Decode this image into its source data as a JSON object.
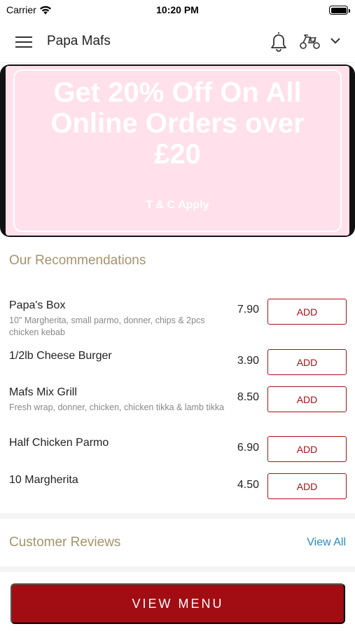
{
  "status_bar": {
    "carrier": "Carrier",
    "time": "10:20 PM"
  },
  "header": {
    "title": "Papa Mafs"
  },
  "banner": {
    "headline": "Get 20% Off On All\nOnline Orders over\n£20",
    "terms": "T & C Apply",
    "background": "#ffe0eb"
  },
  "recommendations": {
    "title": "Our Recommendations",
    "add_label": "ADD",
    "items": [
      {
        "name": "Papa's Box",
        "description": "10\" Margherita, small parmo, donner, chips & 2pcs chicken kebab",
        "price": "7.90"
      },
      {
        "name": "1/2lb Cheese Burger",
        "description": "",
        "price": "3.90"
      },
      {
        "name": "Mafs Mix Grill",
        "description": "Fresh wrap, donner, chicken, chicken tikka & lamb tikka",
        "price": "8.50"
      },
      {
        "name": "Half Chicken Parmo",
        "description": "",
        "price": "6.90"
      },
      {
        "name": "10 Margherita",
        "description": "",
        "price": "4.50"
      }
    ]
  },
  "reviews": {
    "title": "Customer Reviews",
    "view_all": "View All"
  },
  "footer": {
    "view_menu": "VIEW MENU"
  },
  "colors": {
    "accent": "#a10d12",
    "section_title": "#a6936c",
    "link": "#2a8bc4"
  },
  "icons": [
    "menu-icon",
    "bell-icon",
    "scooter-icon",
    "chevron-down-icon",
    "wifi-icon",
    "battery-icon"
  ]
}
